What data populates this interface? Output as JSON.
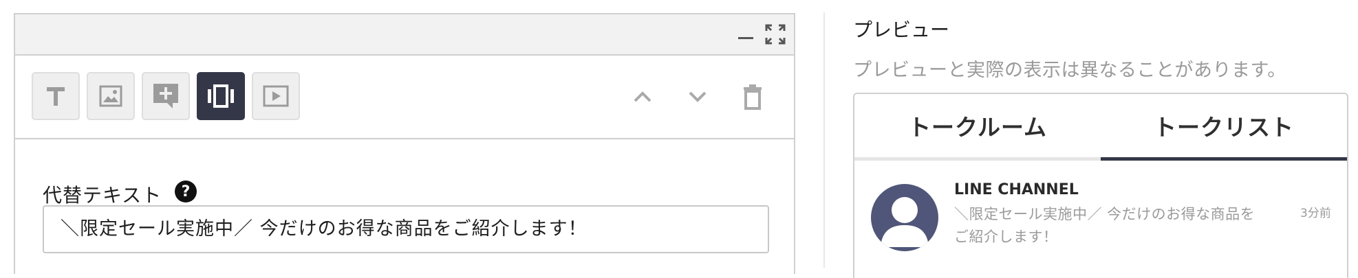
{
  "editor": {
    "header": {
      "minimize_icon": "minimize-icon",
      "maximize_icon": "expand-icon"
    },
    "toolbar": {
      "tools": [
        {
          "icon": "text-icon",
          "active": false
        },
        {
          "icon": "image-icon",
          "active": false
        },
        {
          "icon": "rich-message-icon",
          "active": false
        },
        {
          "icon": "carousel-icon",
          "active": true
        },
        {
          "icon": "video-icon",
          "active": false
        }
      ],
      "actions": [
        "move-up-icon",
        "move-down-icon",
        "trash-icon"
      ]
    },
    "alt_text": {
      "label": "代替テキスト",
      "help": "?",
      "value": "＼限定セール実施中／ 今だけのお得な商品をご紹介します！"
    }
  },
  "preview": {
    "title": "プレビュー",
    "note": "プレビューと実際の表示は異なることがあります。",
    "tabs": [
      {
        "label": "トークルーム",
        "active": false
      },
      {
        "label": "トークリスト",
        "active": true
      }
    ],
    "chat": {
      "name": "LINE CHANNEL",
      "message": "＼限定セール実施中／ 今だけのお得な商品をご紹介します！",
      "time": "3分前"
    }
  },
  "colors": {
    "active_tool": "#343747",
    "avatar": "#4f5679",
    "muted_text": "#9a9a9a",
    "border": "#cfcfcf"
  }
}
